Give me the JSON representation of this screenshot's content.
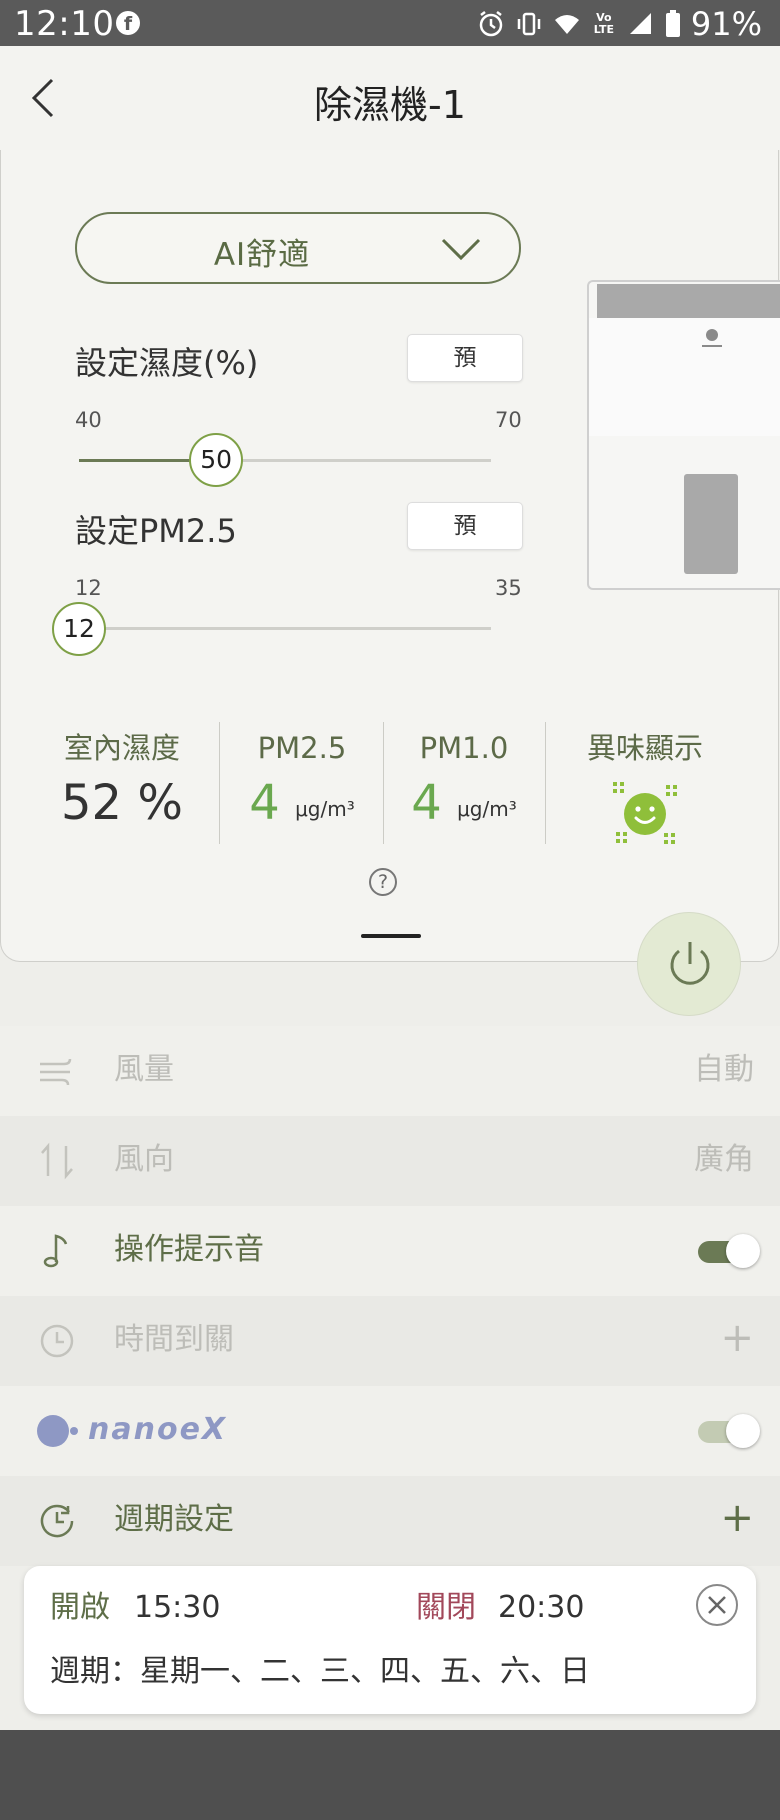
{
  "status_bar": {
    "time": "12:10",
    "battery": "91%",
    "fb_glyph": "f",
    "volte": "Vo LTE"
  },
  "header": {
    "title": "除濕機-1"
  },
  "mode": {
    "label": "AI舒適"
  },
  "humidity": {
    "label": "設定濕度(%)",
    "preset_label": "預",
    "min": "40",
    "max": "70",
    "value": "50",
    "level_fraction": 0.333
  },
  "pm25_setting": {
    "label": "設定PM2.5",
    "preset_label": "預",
    "min": "12",
    "max": "35",
    "value": "12",
    "level_fraction": 0.0
  },
  "stats": {
    "humidity": {
      "label": "室內濕度",
      "value": "52 %"
    },
    "pm25": {
      "label": "PM2.5",
      "value": "4",
      "unit": "μg/m³"
    },
    "pm10": {
      "label": "PM1.0",
      "value": "4",
      "unit": "μg/m³"
    },
    "odor": {
      "label": "異味顯示"
    }
  },
  "help_glyph": "?",
  "rows": {
    "fan_volume": {
      "label": "風量",
      "value": "自動"
    },
    "fan_direction": {
      "label": "風向",
      "value": "廣角"
    },
    "beep": {
      "label": "操作提示音",
      "on": true
    },
    "off_timer": {
      "label": "時間到關",
      "action": "+"
    },
    "nanoe": {
      "label": "nanoeX",
      "on": true
    },
    "weekly": {
      "label": "週期設定",
      "action": "+"
    }
  },
  "schedule": {
    "on_label": "開啟",
    "on_time": "15:30",
    "off_label": "關閉",
    "off_time": "20:30",
    "cycle": "週期：星期一、二、三、四、五、六、日"
  },
  "colors": {
    "accent": "#6b7a55",
    "green": "#6aa84f",
    "off_red": "#a2485a",
    "disabled": "#bdbdb8"
  }
}
